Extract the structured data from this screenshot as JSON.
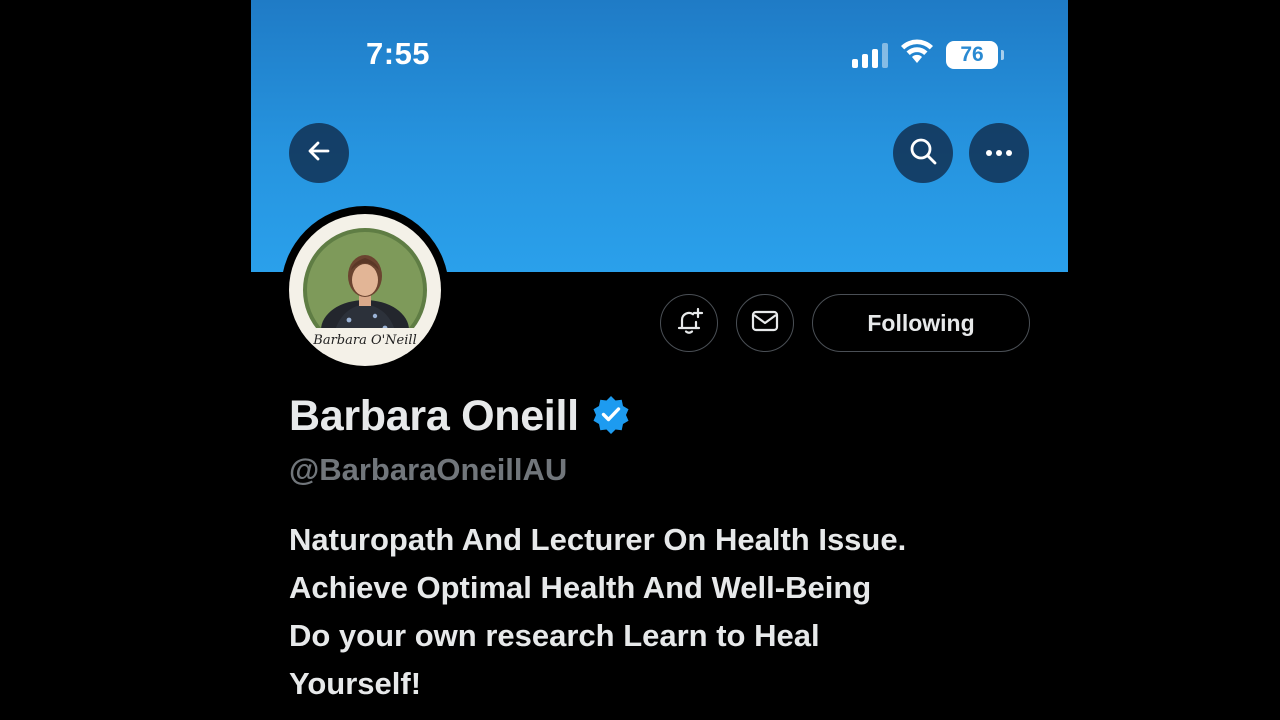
{
  "status_bar": {
    "time": "7:55",
    "battery_level": "76",
    "signal_bars_active": 3,
    "signal_bars_total": 4,
    "wifi": "wifi-icon"
  },
  "header": {
    "back_icon": "arrow-left-icon",
    "search_icon": "search-icon",
    "more_icon": "more-dots-icon"
  },
  "profile": {
    "avatar_caption": "Barbara O'Neill",
    "display_name": "Barbara Oneill",
    "verified": true,
    "handle": "@BarbaraOneillAU",
    "bio_lines": [
      "Naturopath And Lecturer On Health Issue.",
      "Achieve Optimal Health And Well-Being",
      "Do your own research Learn to Heal",
      "Yourself!"
    ]
  },
  "actions": {
    "notify_icon": "bell-plus-icon",
    "message_icon": "envelope-icon",
    "following_label": "Following"
  },
  "colors": {
    "banner_top": "#1f7bc6",
    "banner_bottom": "#2aa0eb",
    "verified_badge": "#1d9bf0",
    "text_primary": "#e7e9ea",
    "text_secondary": "#71767b",
    "background": "#000000"
  }
}
